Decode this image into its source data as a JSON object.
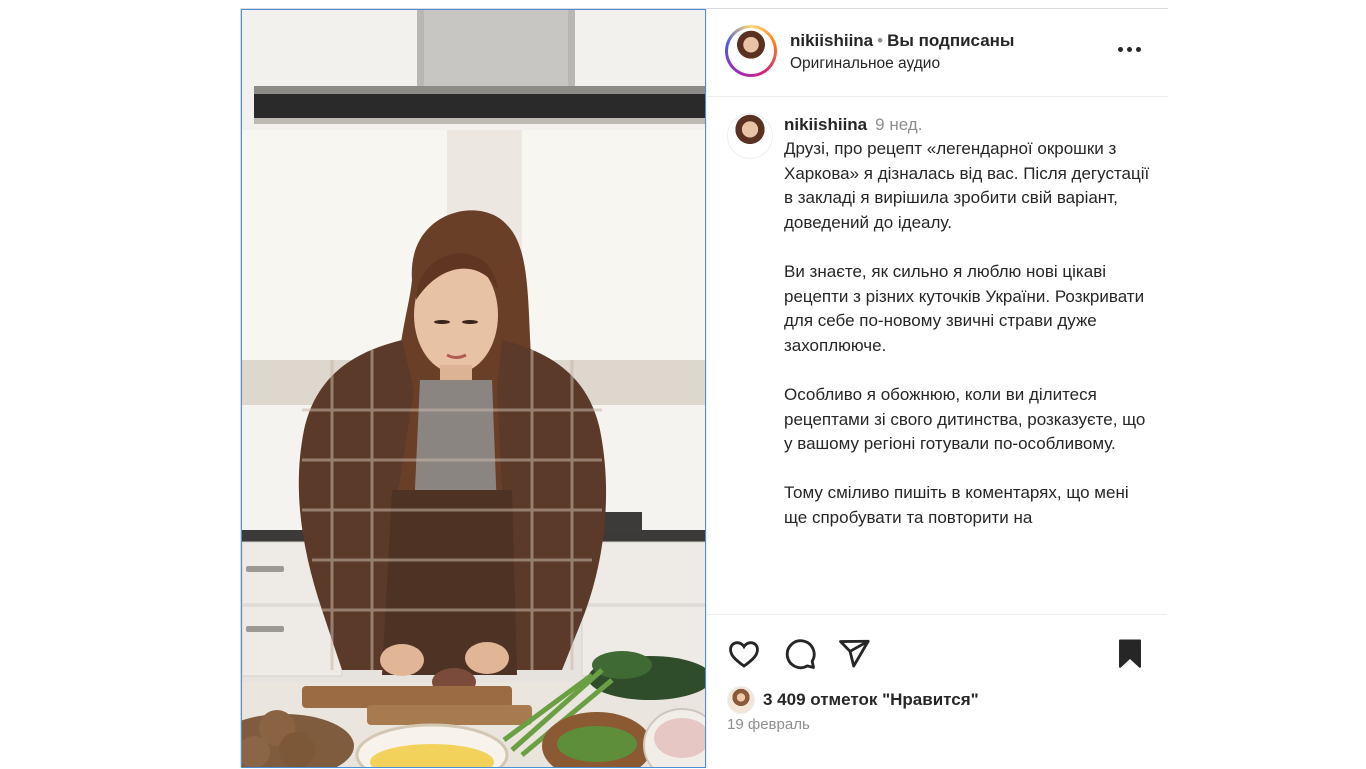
{
  "post": {
    "username": "nikiishiina",
    "follow_status": "Вы подписаны",
    "audio_label": "Оригинальное аудио",
    "caption": {
      "author": "nikiishiina",
      "time_ago": "9 нед.",
      "paragraphs": [
        "Друзі, про рецепт «легендарної окрошки з Харкова» я дізналась від вас. Після дегустації в закладі я вирішила зробити свій варіант, доведений до ідеалу.",
        "Ви знаєте, як сильно я люблю нові цікаві рецепти з різних куточків України. Розкривати для себе по-новому звичні страви дуже захоплююче.",
        "Особливо я обожнюю, коли ви ділитеся рецептами зі свого дитинства, розказуєте, що у вашому регіоні готували по-особливому.",
        "Тому сміливо пишіть в коментарях, що мені ще спробувати та повторити на"
      ]
    },
    "likes_text": "3 409 отметок \"Нравится\"",
    "date": "19 февраль"
  },
  "icons": {
    "more": "more-icon",
    "like": "heart-icon",
    "comment": "comment-icon",
    "share": "paper-plane-icon",
    "save": "bookmark-icon"
  },
  "colors": {
    "text": "#262626",
    "secondary": "#8e8e8e",
    "border": "#dbdbdb"
  }
}
